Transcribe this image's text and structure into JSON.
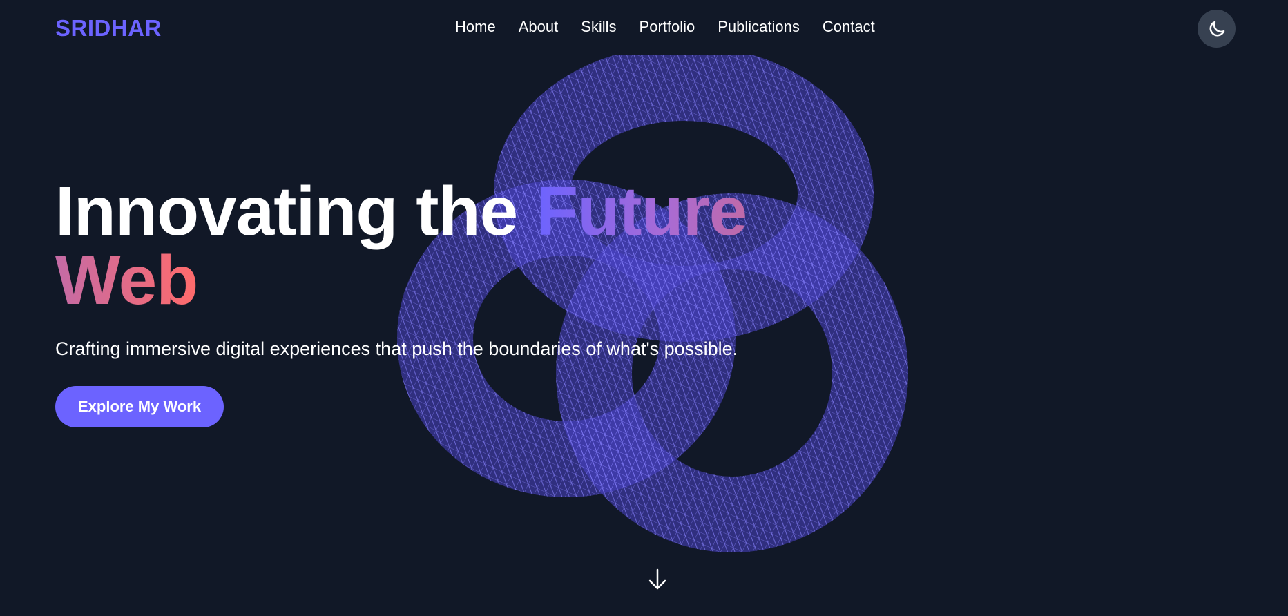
{
  "nav": {
    "logo": "SRIDHAR",
    "links": [
      {
        "label": "Home"
      },
      {
        "label": "About"
      },
      {
        "label": "Skills"
      },
      {
        "label": "Portfolio"
      },
      {
        "label": "Publications"
      },
      {
        "label": "Contact"
      }
    ],
    "theme_toggle_icon": "moon-icon"
  },
  "hero": {
    "title_part1": "Innovating the ",
    "title_highlight": "Future",
    "title_line2": "Web",
    "subtitle": "Crafting immersive digital experiences that push the boundaries of what's possible.",
    "cta_label": "Explore My Work",
    "scroll_icon": "arrow-down-icon"
  },
  "colors": {
    "background": "#111827",
    "accent": "#6c63ff",
    "gradient_end": "#ff6b6b",
    "wireframe": "#5b52e6",
    "toggle_bg": "#374151"
  }
}
